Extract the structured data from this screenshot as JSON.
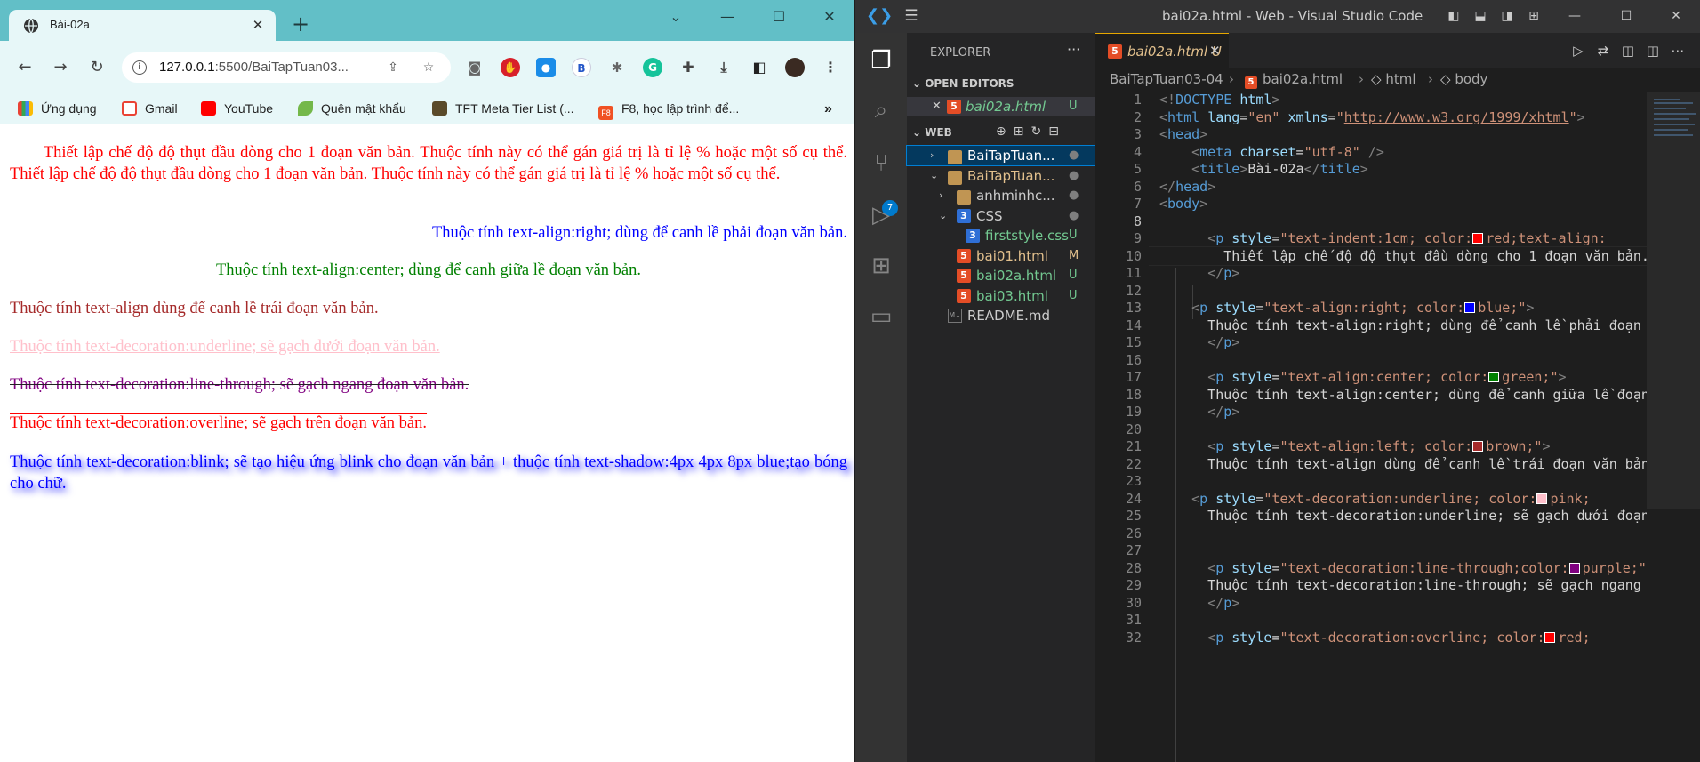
{
  "browser": {
    "tab_title": "Bài-02a",
    "url_host": "127.0.0.1",
    "url_rest": ":5500/BaiTapTuan03...",
    "bookmarks": [
      "Ứng dụng",
      "Gmail",
      "YouTube",
      "Quên mật khẩu",
      "TFT Meta Tier List (...",
      "F8, học lập trình để..."
    ],
    "bookmarks_more": "»",
    "extension_b": "B",
    "paragraphs": [
      {
        "text": "Thiết lập chế độ độ thụt đầu dòng cho 1 đoạn văn bản. Thuộc tính này có thể gán giá trị là tỉ lệ % hoặc một số cụ thể. Thiết lập chế độ độ thụt đầu dòng cho 1 đoạn văn bản. Thuộc tính này có thể gán giá trị là tỉ lệ % hoặc một số cụ thể.",
        "color": "#ff0000"
      },
      {
        "text": "Thuộc tính text-align:right; dùng để canh lề phải đoạn văn bản.",
        "color": "#0000ff"
      },
      {
        "text": "Thuộc tính text-align:center; dùng để canh giữa lề đoạn văn bản.",
        "color": "#008000"
      },
      {
        "text": "Thuộc tính text-align dùng để canh lề trái đoạn văn bản.",
        "color": "#a52a2a"
      },
      {
        "text": "Thuộc tính text-decoration:underline; sẽ gạch dưới đoạn văn bản.",
        "color": "#ffc0cb"
      },
      {
        "text": "Thuộc tính text-decoration:line-through; sẽ gạch ngang đoạn văn bản.",
        "color": "#800080"
      },
      {
        "text": "Thuộc tính text-decoration:overline; sẽ gạch trên đoạn văn bản.",
        "color": "#ff0000"
      },
      {
        "text": "Thuộc tính text-decoration:blink; sẽ tạo hiệu ứng blink cho đoạn văn bản + thuộc tính text-shadow:4px 4px 8px blue;tạo bóng cho chữ.",
        "color": "#0000ff"
      }
    ]
  },
  "vscode": {
    "window_title": "bai02a.html - Web - Visual Studio Code",
    "scm_badge": "7",
    "explorer_title": "EXPLORER",
    "explorer_more": "···",
    "open_editors_label": "OPEN EDITORS",
    "open_editor_file": "bai02a.html",
    "open_editor_status": "U",
    "web_label": "WEB",
    "tree": [
      {
        "name": "BaiTapTuan...",
        "status": "●",
        "kind": "folder",
        "depth": 1,
        "open": false,
        "selected": true
      },
      {
        "name": "BaiTapTuan...",
        "status": "●",
        "kind": "folder",
        "depth": 1,
        "open": true,
        "selected": false
      },
      {
        "name": "anhminhc...",
        "status": "●",
        "kind": "folder",
        "depth": 2,
        "open": false,
        "selected": false
      },
      {
        "name": "CSS",
        "status": "●",
        "kind": "cssfolder",
        "depth": 2,
        "open": true,
        "selected": false
      },
      {
        "name": "firststyle.css",
        "status": "U",
        "kind": "css",
        "depth": 3,
        "selected": false
      },
      {
        "name": "bai01.html",
        "status": "M",
        "kind": "html",
        "depth": 2,
        "selected": false
      },
      {
        "name": "bai02a.html",
        "status": "U",
        "kind": "html",
        "depth": 2,
        "selected": false
      },
      {
        "name": "bai03.html",
        "status": "U",
        "kind": "html",
        "depth": 2,
        "selected": false
      },
      {
        "name": "README.md",
        "status": "",
        "kind": "md",
        "depth": 1,
        "selected": false
      }
    ],
    "tab_name": "bai02a.html",
    "tab_status": "U",
    "breadcrumbs": [
      "BaiTapTuan03-04",
      "bai02a.html",
      "html",
      "body"
    ],
    "current_line": 8,
    "line_numbers": [
      "1",
      "2",
      "3",
      "4",
      "5",
      "6",
      "7",
      "8",
      "9",
      "10",
      "11",
      "12",
      "13",
      "14",
      "15",
      "16",
      "17",
      "18",
      "19",
      "20",
      "21",
      "22",
      "23",
      "24",
      "25",
      "26",
      "27",
      "28",
      "29",
      "30",
      "31",
      "32"
    ]
  }
}
